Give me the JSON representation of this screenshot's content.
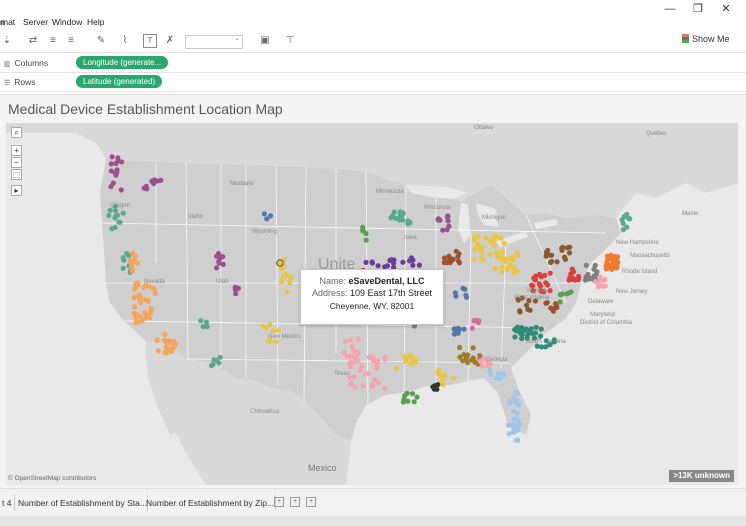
{
  "menu": {
    "items": [
      "n",
      "mat",
      "Server",
      "Window",
      "Help"
    ]
  },
  "window_controls": {
    "minimize": "—",
    "restore": "❐",
    "close": "✕"
  },
  "toolbar": {
    "show_me_label": "Show Me",
    "dropdown_value": ""
  },
  "shelves": {
    "columns": {
      "label": "Columns",
      "pill": "Longitude (generate..."
    },
    "rows": {
      "label": "Rows",
      "pill": "Latitude (generated)"
    }
  },
  "view": {
    "title": "Medical Device Establishment Location Map"
  },
  "map": {
    "labels": {
      "ottawa": "Ottawa",
      "quebec": "Québec",
      "maine": "Maine",
      "new_hampshire": "New Hampshire",
      "massachusetts": "Massachusetts",
      "rhode_island": "Rhode Island",
      "new_jersey": "New Jersey",
      "delaware": "Delaware",
      "maryland": "Maryland",
      "district_of_columbia": "District of Columbia",
      "minnesota": "Minnesota",
      "wisconsin": "Wisconsin",
      "michigan": "Michigan",
      "montana": "Montana",
      "wyoming": "Wyoming",
      "idaho": "Idaho",
      "nevada": "Nevada",
      "utah": "Utah",
      "oregon": "Oregon",
      "texas": "Texas",
      "new_mexico": "New Mexico",
      "chihuahua": "Chihuahua",
      "mexico": "Mexico",
      "united": "Unite",
      "west_virginia": "West Virginia",
      "virginia": "Virginia",
      "iowa": "Iowa",
      "georgia": "Georgia",
      "south_carolina": "South Carolina"
    },
    "attribution": "© OpenStreetMap contributors",
    "unknown_badge": ">13K unknown",
    "controls": {
      "search": "⌕",
      "zoom_in": "+",
      "zoom_out": "−",
      "lasso": "⬚",
      "expand": "▸"
    },
    "colors": {
      "ocean": "#e9e9e9",
      "land": "#d4d4d4",
      "us_land": "#cfcfcf",
      "borders": "#ffffff"
    }
  },
  "tooltip": {
    "name_label": "Name:",
    "name_value": "eSaveDental, LLC",
    "address_label": "Address:",
    "address_value": "109 East 17th Street",
    "city_line": "Cheyenne, WY, 82001"
  },
  "tabs": {
    "items": [
      "t 4",
      "Number of Establishment by Sta...",
      "Number of Establishment by Zip..."
    ]
  }
}
